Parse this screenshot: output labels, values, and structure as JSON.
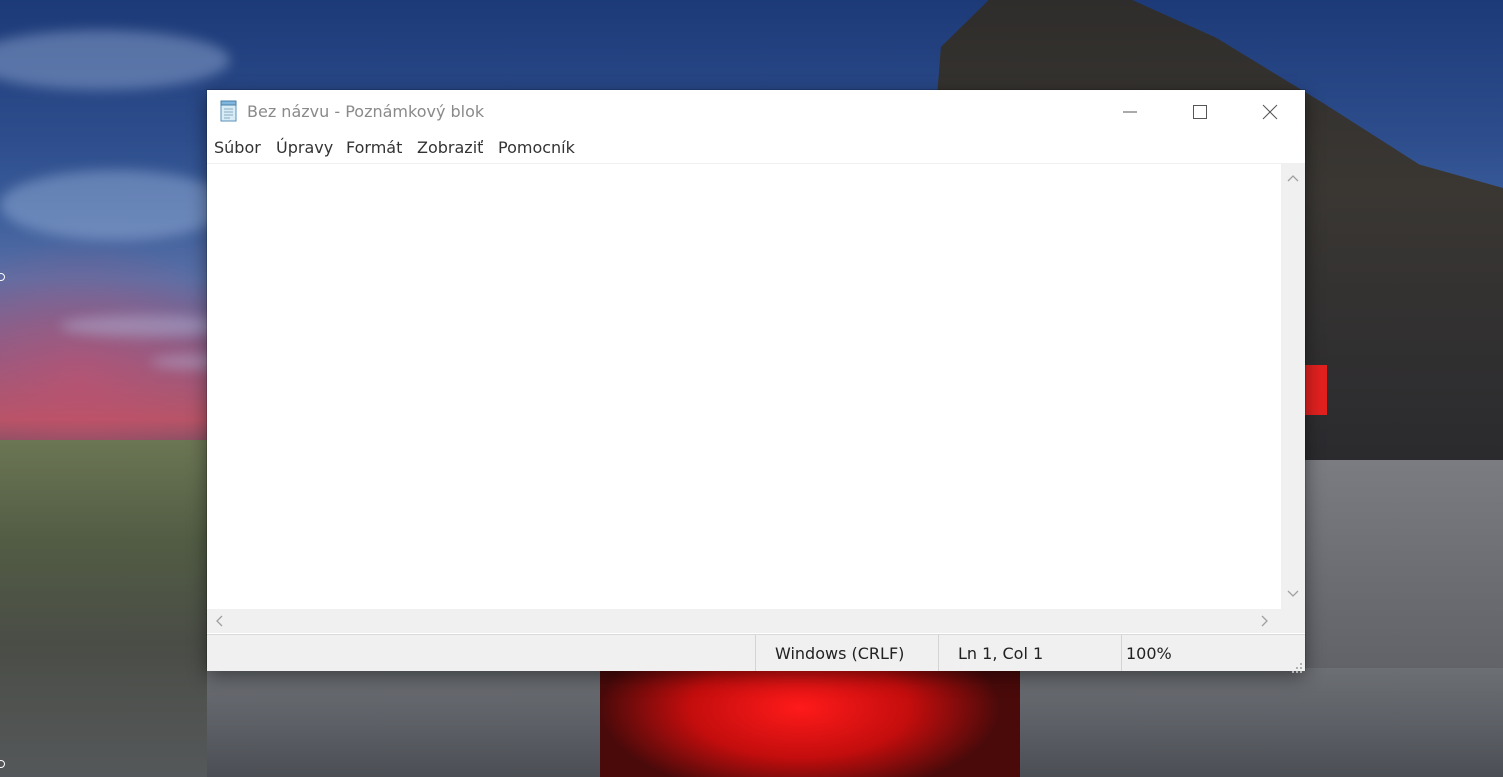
{
  "window": {
    "title": "Bez názvu - Poznámkový blok",
    "app_icon": "notepad-icon",
    "caption_buttons": [
      "minimize-icon",
      "maximize-icon",
      "close-icon"
    ]
  },
  "menu": {
    "items": [
      {
        "label": "Súbor"
      },
      {
        "label": "Úpravy"
      },
      {
        "label": "Formát"
      },
      {
        "label": "Zobraziť"
      },
      {
        "label": "Pomocník"
      }
    ]
  },
  "editor": {
    "content": ""
  },
  "status": {
    "line_endings": "Windows (CRLF)",
    "position": "Ln 1, Col 1",
    "zoom": "100%"
  },
  "colors": {
    "titlebar": "#ffffff",
    "title_text": "#8a8a8a",
    "statusbar": "#f0f0f0",
    "scrollbar": "#f0f0f0"
  }
}
